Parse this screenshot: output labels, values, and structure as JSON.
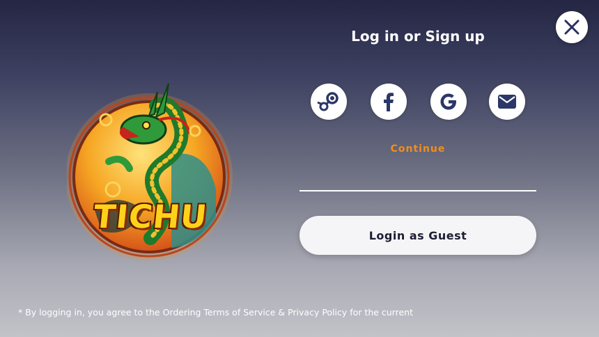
{
  "dialog": {
    "title": "Log in or Sign up",
    "close_icon": "close-icon"
  },
  "logo": {
    "word": "TICHU",
    "icon": "dragon-emblem"
  },
  "social": [
    {
      "name": "steam",
      "icon": "steam-icon"
    },
    {
      "name": "facebook",
      "icon": "facebook-icon"
    },
    {
      "name": "google",
      "icon": "google-icon"
    },
    {
      "name": "email",
      "icon": "mail-icon"
    }
  ],
  "continue_label": "Continue",
  "guest_button_label": "Login as Guest",
  "footer_text": "* By logging in, you agree to the Ordering Terms of Service & Privacy Policy for the current",
  "colors": {
    "accent_orange": "#f38d1b",
    "button_text": "#1d1d33",
    "logo_yellow": "#ffd21a"
  }
}
